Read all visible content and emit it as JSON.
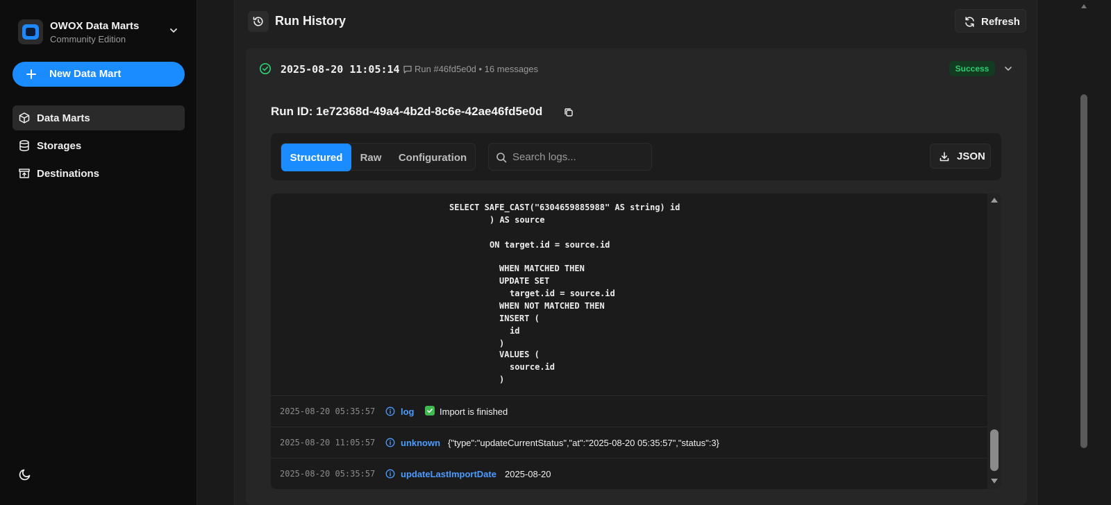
{
  "sidebar": {
    "brand": {
      "title": "OWOX Data Marts",
      "subtitle": "Community Edition"
    },
    "new_button": "New Data Mart",
    "items": [
      {
        "label": "Data Marts",
        "icon": "cube-icon",
        "active": true
      },
      {
        "label": "Storages",
        "icon": "database-icon",
        "active": false
      },
      {
        "label": "Destinations",
        "icon": "destination-icon",
        "active": false
      }
    ],
    "theme_icon": "moon-icon"
  },
  "header": {
    "title": "Run History",
    "refresh_label": "Refresh"
  },
  "run": {
    "time": "2025-08-20 11:05:14",
    "meta": "Run #46fd5e0d • 16 messages",
    "status": "Success",
    "run_id": "Run ID: 1e72368d-49a4-4b2d-8c6e-42ae46fd5e0d"
  },
  "toolbar": {
    "tabs": [
      "Structured",
      "Raw",
      "Configuration"
    ],
    "active_tab": "Structured",
    "search_placeholder": "Search logs...",
    "json_label": "JSON"
  },
  "code_lines": [
    "SELECT SAFE_CAST(\"6304659885988\" AS string) id",
    ") AS source",
    "ON target.id = source.id",
    "WHEN MATCHED THEN",
    "UPDATE SET",
    "target.id = source.id",
    "WHEN NOT MATCHED THEN",
    "INSERT (",
    "id",
    ")",
    "VALUES (",
    "source.id",
    ")"
  ],
  "logs": [
    {
      "time": "2025-08-20 05:35:57",
      "type": "log",
      "message": "Import is finished"
    },
    {
      "time": "2025-08-20 11:05:57",
      "type": "unknown",
      "message": "{\"type\":\"updateCurrentStatus\",\"at\":\"2025-08-20 05:35:57\",\"status\":3}"
    },
    {
      "time": "2025-08-20 05:35:57",
      "type": "updateLastImportDate",
      "message": "2025-08-20"
    }
  ],
  "colors": {
    "accent": "#1a8cff",
    "success": "#2ecc71",
    "link": "#4c9bff"
  }
}
